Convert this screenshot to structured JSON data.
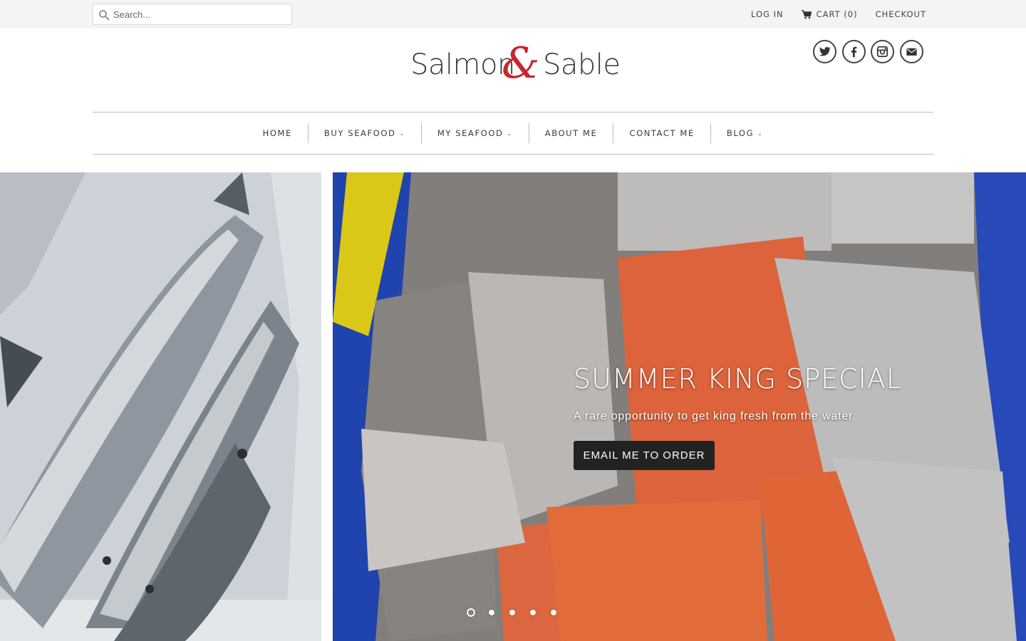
{
  "search": {
    "placeholder": "Search..."
  },
  "toplinks": {
    "login": "LOG IN",
    "cart": "CART (0)",
    "checkout": "CHECKOUT"
  },
  "logo": {
    "word1": "Salmon",
    "amp": "&",
    "word2": "Sable"
  },
  "social": [
    "twitter-icon",
    "facebook-icon",
    "instagram-icon",
    "email-icon"
  ],
  "nav": {
    "home": "HOME",
    "buy_seafood": "BUY SEAFOOD",
    "my_seafood": "MY SEAFOOD",
    "about": "ABOUT ME",
    "contact": "CONTACT ME",
    "blog": "BLOG"
  },
  "slide": {
    "title": "SUMMER KING SPECIAL",
    "subtitle": "A rare opportunity to get king fresh from the water",
    "button": "EMAIL ME TO ORDER"
  },
  "slider": {
    "count": 5,
    "active_index": 0
  },
  "colors": {
    "brand_red": "#c8262f",
    "topbar_bg": "#f4f4f4",
    "button_bg": "#222222"
  }
}
